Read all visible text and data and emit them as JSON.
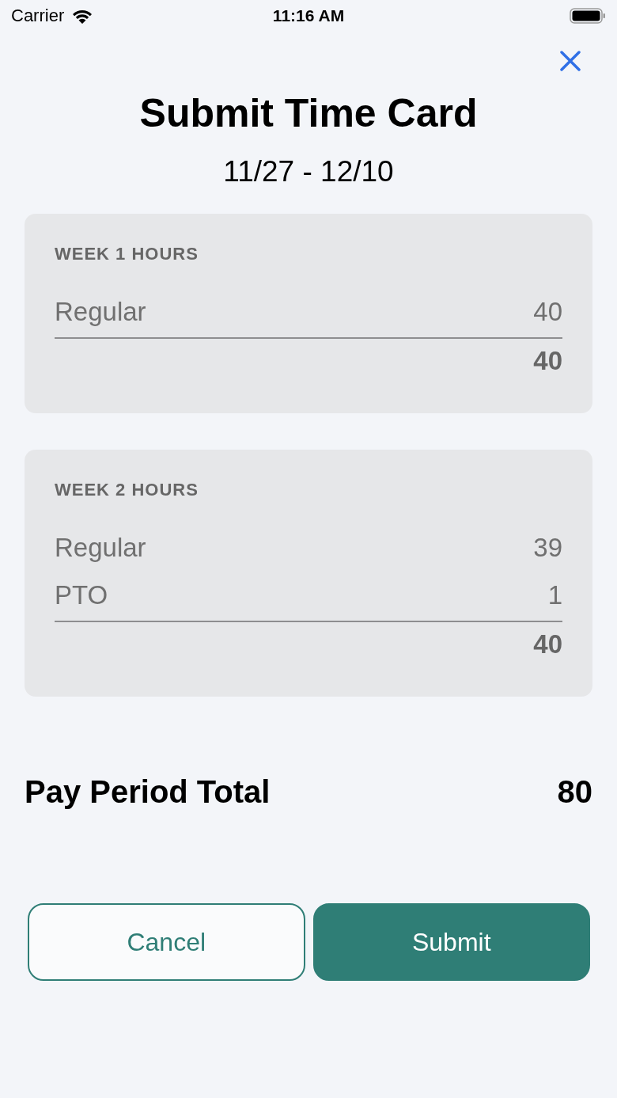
{
  "status_bar": {
    "carrier": "Carrier",
    "time": "11:16 AM"
  },
  "title": "Submit Time Card",
  "period": "11/27 - 12/10",
  "weeks": [
    {
      "heading": "WEEK 1 HOURS",
      "rows": [
        {
          "label": "Regular",
          "hours": "40"
        }
      ],
      "total": "40"
    },
    {
      "heading": "WEEK 2 HOURS",
      "rows": [
        {
          "label": "Regular",
          "hours": "39"
        },
        {
          "label": "PTO",
          "hours": "1"
        }
      ],
      "total": "40"
    }
  ],
  "pay_period_total": {
    "label": "Pay Period Total",
    "value": "80"
  },
  "buttons": [
    {
      "label": "Cancel",
      "kind": "secondary"
    },
    {
      "label": "Submit",
      "kind": "primary"
    }
  ]
}
